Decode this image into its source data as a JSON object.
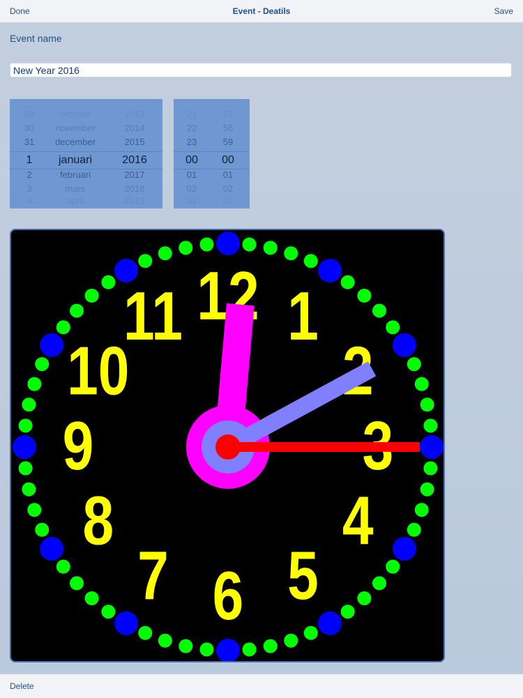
{
  "nav": {
    "done_label": "Done",
    "title": "Event - Deatils",
    "save_label": "Save"
  },
  "event": {
    "name_label": "Event name",
    "name_value": "New Year 2016"
  },
  "date_picker": {
    "rows": [
      {
        "day": "29",
        "month": "oktober",
        "year": "2013",
        "state": "faded2"
      },
      {
        "day": "30",
        "month": "november",
        "year": "2014",
        "state": "faded"
      },
      {
        "day": "31",
        "month": "december",
        "year": "2015",
        "state": "normal"
      },
      {
        "day": "1",
        "month": "januari",
        "year": "2016",
        "state": "selected"
      },
      {
        "day": "2",
        "month": "februari",
        "year": "2017",
        "state": "normal"
      },
      {
        "day": "3",
        "month": "mars",
        "year": "2018",
        "state": "faded"
      },
      {
        "day": "4",
        "month": "april",
        "year": "2019",
        "state": "faded2"
      }
    ]
  },
  "time_picker": {
    "rows": [
      {
        "hour": "21",
        "minute": "57",
        "state": "faded2"
      },
      {
        "hour": "22",
        "minute": "58",
        "state": "faded"
      },
      {
        "hour": "23",
        "minute": "59",
        "state": "normal"
      },
      {
        "hour": "00",
        "minute": "00",
        "state": "selected"
      },
      {
        "hour": "01",
        "minute": "01",
        "state": "normal"
      },
      {
        "hour": "02",
        "minute": "02",
        "state": "faded"
      },
      {
        "hour": "03",
        "minute": "03",
        "state": "faded2"
      }
    ]
  },
  "clock": {
    "numerals": [
      "12",
      "1",
      "2",
      "3",
      "4",
      "5",
      "6",
      "7",
      "8",
      "9",
      "10",
      "11"
    ],
    "colors": {
      "face": "#000000",
      "numeral": "#ffff00",
      "minute_dot": "#00ff00",
      "hour_dot": "#0000ff",
      "hour_hand": "#ff00ff",
      "minute_hand": "#8080ff",
      "second_hand": "#ff0000"
    },
    "hand_values": {
      "hour": 12,
      "minute": 10,
      "second": 15
    }
  },
  "footer": {
    "delete_label": "Delete"
  }
}
